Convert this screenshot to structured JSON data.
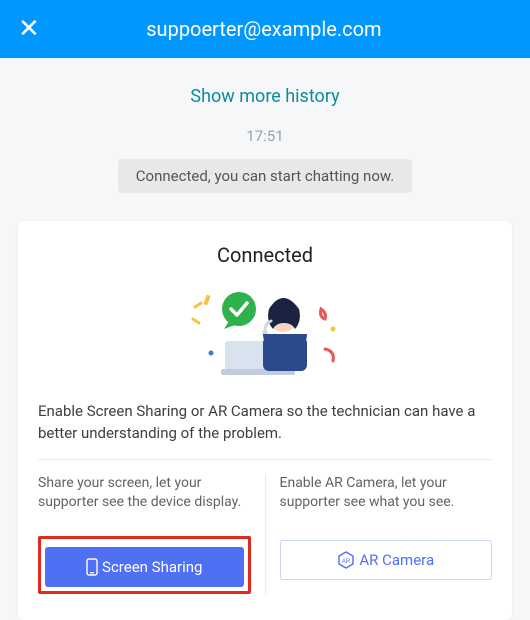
{
  "header": {
    "title": "suppoerter@example.com"
  },
  "history_link": "Show more history",
  "timestamp": "17:51",
  "status_message": "Connected, you can start chatting now.",
  "card": {
    "title": "Connected",
    "prompt": "Enable Screen Sharing or AR Camera so the technician can have a better understanding of the problem.",
    "screen_sharing": {
      "desc": "Share your screen, let your supporter see the device display.",
      "button": "Screen Sharing"
    },
    "ar_camera": {
      "desc": "Enable AR Camera, let your supporter see what you see.",
      "button": "AR Camera"
    }
  }
}
